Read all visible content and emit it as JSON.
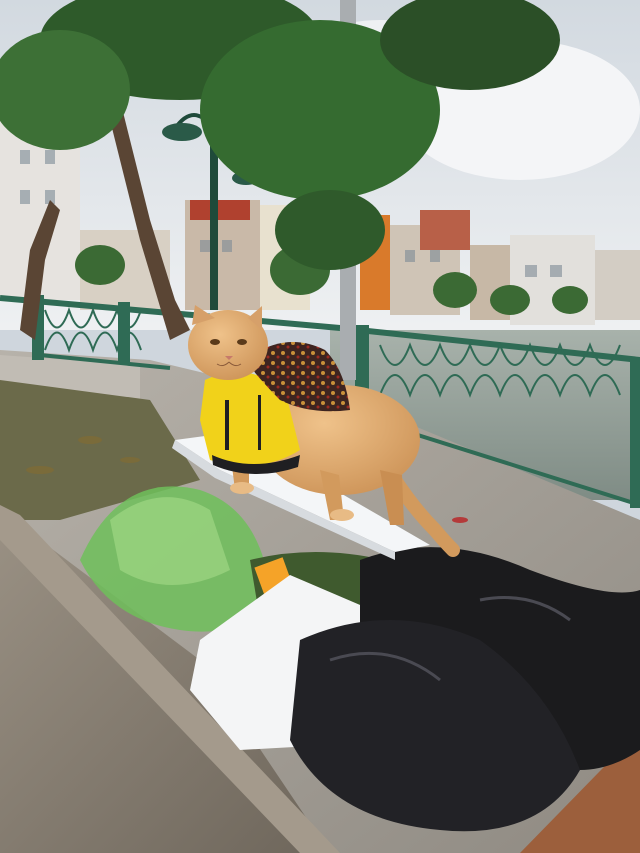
{
  "image": {
    "kind": "photograph",
    "palette": {
      "sky": "#dfe4ea",
      "cloud": "#f2f4f6",
      "water": "#9aa7a0",
      "railing": "#2f6b55",
      "sidewalk": "#a9a49c",
      "tree_green": "#2e5a2a",
      "trunk": "#5a4534",
      "cat_fur": "#d9a66b",
      "shirt_yellow": "#f1d21a",
      "cape": "#4a2a24",
      "trash_bag": "#1b1b1d",
      "bin_concrete": "#8a8175"
    }
  }
}
